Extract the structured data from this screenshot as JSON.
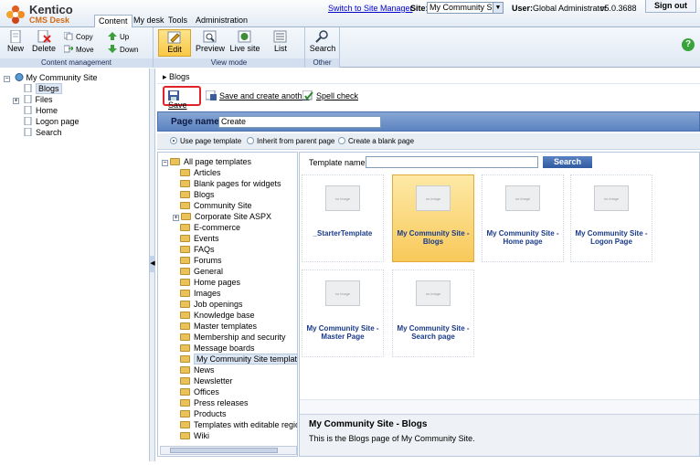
{
  "app": {
    "logo_main": "Kentico",
    "logo_sub": "CMS Desk"
  },
  "header": {
    "tabs": [
      "Content",
      "My desk",
      "Tools",
      "Administration"
    ],
    "switch_link": "Switch to Site Manager",
    "site_label": "Site:",
    "site_value": "My Community Site",
    "user_label": "User:",
    "user_value": "Global Administrator",
    "version": "v5.0.3688",
    "signout": "Sign out"
  },
  "toolbar": {
    "content_management": {
      "caption": "Content management",
      "new": "New",
      "delete": "Delete",
      "copy": "Copy",
      "move": "Move",
      "up": "Up",
      "down": "Down"
    },
    "view_mode": {
      "caption": "View mode",
      "edit": "Edit",
      "preview": "Preview",
      "live_site": "Live site",
      "list": "List"
    },
    "other": {
      "caption": "Other",
      "search": "Search"
    },
    "help": "?"
  },
  "content_tree": {
    "root": "My Community Site",
    "items": [
      "Blogs",
      "Files",
      "Home",
      "Logon page",
      "Search"
    ]
  },
  "breadcrumb": "Blogs",
  "actions": {
    "save": "Save",
    "save_create": "Save and create another",
    "spell": "Spell check"
  },
  "page_name": {
    "label": "Page name:",
    "value": "Create"
  },
  "options": [
    "Use page template",
    "Inherit from parent page",
    "Create a blank page"
  ],
  "template_tree": {
    "root": "All page templates",
    "items": [
      "Articles",
      "Blank pages for widgets",
      "Blogs",
      "Community Site",
      "Corporate Site ASPX",
      "E-commerce",
      "Events",
      "FAQs",
      "Forums",
      "General",
      "Home pages",
      "Images",
      "Job openings",
      "Knowledge base",
      "Master templates",
      "Membership and security",
      "Message boards",
      "My Community Site templates",
      "News",
      "Newsletter",
      "Offices",
      "Press releases",
      "Products",
      "Templates with editable regio",
      "Wiki"
    ]
  },
  "template_search": {
    "label": "Template name:",
    "button": "Search",
    "value": ""
  },
  "templates": [
    {
      "title": "_StarterTemplate",
      "image": "no image"
    },
    {
      "title": "My Community Site - Blogs",
      "image": "no image"
    },
    {
      "title": "My Community Site - Home page",
      "image": "no image"
    },
    {
      "title": "My Community Site - Logon Page",
      "image": "no image"
    },
    {
      "title": "My Community Site - Master Page",
      "image": "no image"
    },
    {
      "title": "My Community Site - Search page",
      "image": "no image"
    }
  ],
  "selected_template": {
    "name": "My Community Site - Blogs",
    "description": "This is the Blogs page of My Community Site."
  }
}
